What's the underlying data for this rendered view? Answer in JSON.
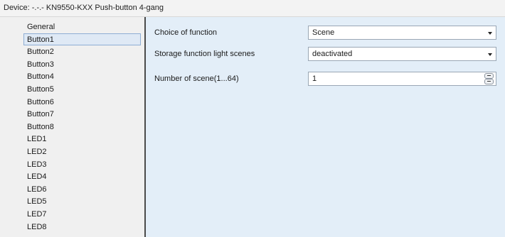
{
  "header": {
    "title": "Device: -.-.- KN9550-KXX Push-button 4-gang"
  },
  "sidebar": {
    "items": [
      {
        "label": "General",
        "selected": false
      },
      {
        "label": "Button1",
        "selected": true
      },
      {
        "label": "Button2",
        "selected": false
      },
      {
        "label": "Button3",
        "selected": false
      },
      {
        "label": "Button4",
        "selected": false
      },
      {
        "label": "Button5",
        "selected": false
      },
      {
        "label": "Button6",
        "selected": false
      },
      {
        "label": "Button7",
        "selected": false
      },
      {
        "label": "Button8",
        "selected": false
      },
      {
        "label": "LED1",
        "selected": false
      },
      {
        "label": "LED2",
        "selected": false
      },
      {
        "label": "LED3",
        "selected": false
      },
      {
        "label": "LED4",
        "selected": false
      },
      {
        "label": "LED6",
        "selected": false
      },
      {
        "label": "LED5",
        "selected": false
      },
      {
        "label": "LED7",
        "selected": false
      },
      {
        "label": "LED8",
        "selected": false
      }
    ]
  },
  "params": {
    "choice_of_function": {
      "label": "Choice of function",
      "value": "Scene"
    },
    "storage_function": {
      "label": "Storage function light scenes",
      "value": "deactivated"
    },
    "number_of_scene": {
      "label": "Number of scene(1...64)",
      "value": "1"
    }
  },
  "colors": {
    "panel_background": "#e3eef8",
    "sidebar_background": "#f0f0f0",
    "selection_background": "#dfe9f5",
    "selection_border": "#8eaed4"
  }
}
